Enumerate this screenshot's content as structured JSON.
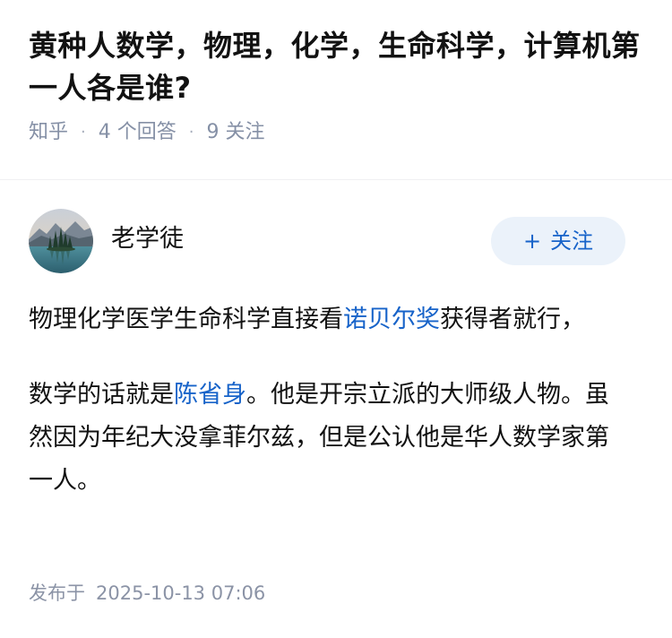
{
  "question": {
    "title": "黄种人数学，物理，化学，生命科学，计算机第一人各是谁?",
    "site": "知乎",
    "answer_count": "4 个回答",
    "follow_count": "9 关注"
  },
  "answer": {
    "author": {
      "name": "老学徒",
      "follow_label": "关注",
      "follow_icon": "plus-icon"
    },
    "paragraph1": {
      "text_before": "物理化学医学生命科学直接看",
      "link": "诺贝尔奖",
      "text_after": "获得者就行，"
    },
    "paragraph2": {
      "text_before": "数学的话就是",
      "link": "陈省身",
      "text_after": "。他是开宗立派的大师级人物。虽然因为年纪大没拿菲尔兹，但是公认他是华人数学家第一人。"
    },
    "publish_label": "发布于",
    "publish_time": "2025-10-13 07:06"
  },
  "colors": {
    "link": "#1763c9",
    "follow_button_bg": "#ebf2fa",
    "meta_text": "#8590a6"
  }
}
